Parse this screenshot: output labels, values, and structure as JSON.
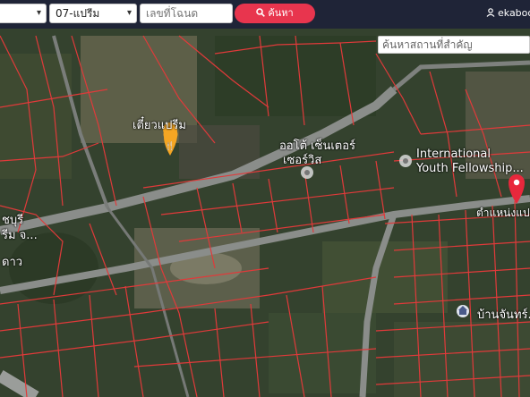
{
  "header": {
    "province_select": "",
    "district_select": "07-แปรีม",
    "deed_placeholder": "เลขที่โฉนด",
    "search_button": "ค้นหา",
    "user_name": "ekaboo"
  },
  "map": {
    "place_search_placeholder": "ค้นหาสถานที่สำคัญ",
    "labels": {
      "restaurant": "เตี๋ยวแปรีม",
      "auto_center_line1": "ออโต้ เซ็นเตอร์",
      "auto_center_line2": "เซอร์วิส",
      "ifyouth_line1": "International",
      "ifyouth_line2": "Youth Fellowship...",
      "left_cut_1": "ชบุรี",
      "left_cut_2": "รีม จ...",
      "left_cut_3": "ดาว",
      "pin_label": "ตำแหน่งแปล",
      "village": "บ้านจันทร์..."
    },
    "colors": {
      "parcel_lines": "#e03a3a",
      "pin": "#e8283c",
      "poi_orange": "#f5a623"
    },
    "icons": [
      "search-icon",
      "user-icon",
      "chevron-down-icon",
      "restaurant-pin-icon",
      "place-pin-icon",
      "location-pin-icon",
      "home-icon"
    ]
  }
}
